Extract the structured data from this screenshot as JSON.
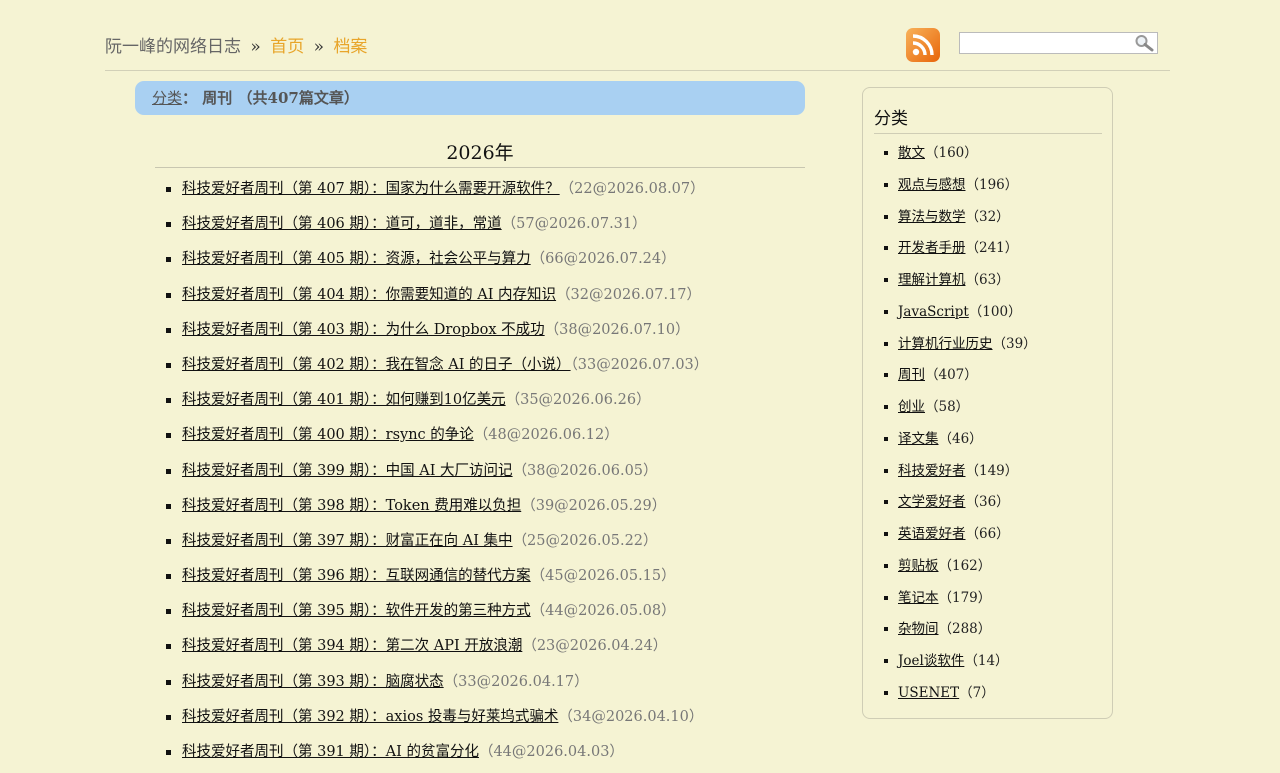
{
  "header": {
    "site_title": "阮一峰的网络日志",
    "separator": "»",
    "home_label": "首页",
    "archive_label": "档案",
    "search": {
      "value": "",
      "placeholder": ""
    }
  },
  "category_bar": {
    "category_link": "分类",
    "colon": "：",
    "category_name": "周刊",
    "count_text": "（共407篇文章）"
  },
  "year_heading": "2026年",
  "articles": [
    {
      "title": "科技爱好者周刊（第 407 期）：国家为什么需要开源软件？",
      "meta": "（22@2026.08.07）"
    },
    {
      "title": "科技爱好者周刊（第 406 期）：道可，道非，常道",
      "meta": "（57@2026.07.31）"
    },
    {
      "title": "科技爱好者周刊（第 405 期）：资源，社会公平与算力",
      "meta": "（66@2026.07.24）"
    },
    {
      "title": "科技爱好者周刊（第 404 期）：你需要知道的 AI 内存知识",
      "meta": "（32@2026.07.17）"
    },
    {
      "title": "科技爱好者周刊（第 403 期）：为什么 Dropbox 不成功",
      "meta": "（38@2026.07.10）"
    },
    {
      "title": "科技爱好者周刊（第 402 期）：我在智念 AI 的日子（小说）",
      "meta": "（33@2026.07.03）"
    },
    {
      "title": "科技爱好者周刊（第 401 期）：如何赚到10亿美元",
      "meta": "（35@2026.06.26）"
    },
    {
      "title": "科技爱好者周刊（第 400 期）：rsync 的争论",
      "meta": "（48@2026.06.12）"
    },
    {
      "title": "科技爱好者周刊（第 399 期）：中国 AI 大厂访问记",
      "meta": "（38@2026.06.05）"
    },
    {
      "title": "科技爱好者周刊（第 398 期）：Token 费用难以负担",
      "meta": "（39@2026.05.29）"
    },
    {
      "title": "科技爱好者周刊（第 397 期）：财富正在向 AI 集中",
      "meta": "（25@2026.05.22）"
    },
    {
      "title": "科技爱好者周刊（第 396 期）：互联网通信的替代方案",
      "meta": "（45@2026.05.15）"
    },
    {
      "title": "科技爱好者周刊（第 395 期）：软件开发的第三种方式",
      "meta": "（44@2026.05.08）"
    },
    {
      "title": "科技爱好者周刊（第 394 期）：第二次 API 开放浪潮",
      "meta": "（23@2026.04.24）"
    },
    {
      "title": "科技爱好者周刊（第 393 期）：脑腐状态",
      "meta": "（33@2026.04.17）"
    },
    {
      "title": "科技爱好者周刊（第 392 期）：axios 投毒与好莱坞式骗术",
      "meta": "（34@2026.04.10）"
    },
    {
      "title": "科技爱好者周刊（第 391 期）：AI 的贫富分化",
      "meta": "（44@2026.04.03）"
    }
  ],
  "sidebar": {
    "title": "分类",
    "categories": [
      {
        "name": "散文",
        "count": "（160）"
      },
      {
        "name": "观点与感想",
        "count": "（196）"
      },
      {
        "name": "算法与数学",
        "count": "（32）"
      },
      {
        "name": "开发者手册",
        "count": "（241）"
      },
      {
        "name": "理解计算机",
        "count": "（63）"
      },
      {
        "name": "JavaScript",
        "count": "（100）"
      },
      {
        "name": "计算机行业历史",
        "count": "（39）"
      },
      {
        "name": "周刊",
        "count": "（407）"
      },
      {
        "name": "创业",
        "count": "（58）"
      },
      {
        "name": "译文集",
        "count": "（46）"
      },
      {
        "name": "科技爱好者",
        "count": "（149）"
      },
      {
        "name": "文学爱好者",
        "count": "（36）"
      },
      {
        "name": "英语爱好者",
        "count": "（66）"
      },
      {
        "name": "剪贴板",
        "count": "（162）"
      },
      {
        "name": "笔记本",
        "count": "（179）"
      },
      {
        "name": "杂物间",
        "count": "（288）"
      },
      {
        "name": "Joel谈软件",
        "count": "（14）"
      },
      {
        "name": "USENET",
        "count": "（7）"
      }
    ]
  },
  "colors": {
    "background": "#f5f3d3",
    "link_orange": "#e8a52a",
    "category_bar": "#a9d0f2"
  },
  "icons": {
    "feed": "rss-icon",
    "search": "search-icon"
  }
}
